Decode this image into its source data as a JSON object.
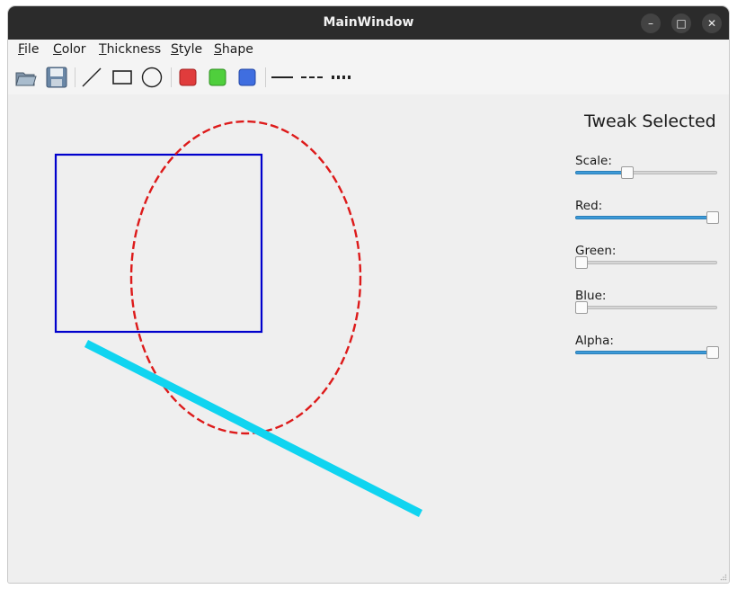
{
  "window": {
    "title": "MainWindow"
  },
  "menu": {
    "file": "File",
    "color": "Color",
    "thickness": "Thickness",
    "style": "Style",
    "shape": "Shape"
  },
  "toolbar": {
    "icons": [
      "open-folder-icon",
      "save-icon",
      "line-tool-icon",
      "rectangle-tool-icon",
      "ellipse-tool-icon",
      "red-color-icon",
      "green-color-icon",
      "blue-color-icon",
      "solid-line-style-icon",
      "dashed-line-style-icon",
      "dotted-line-style-icon"
    ],
    "colors": {
      "red": "#e03c3c",
      "green": "#4fcf3c",
      "blue": "#3f6ee0"
    }
  },
  "canvas": {
    "shapes": [
      {
        "type": "rectangle",
        "stroke": "#0000cc",
        "style": "solid"
      },
      {
        "type": "ellipse",
        "stroke": "#dd1a1a",
        "style": "dashed"
      },
      {
        "type": "line",
        "stroke": "#10d4f0",
        "style": "solid"
      }
    ]
  },
  "panel": {
    "title": "Tweak Selected",
    "sliders": [
      {
        "label": "Scale:",
        "value": 0.35
      },
      {
        "label": "Red:",
        "value": 1.0
      },
      {
        "label": "Green:",
        "value": 0.0
      },
      {
        "label": "Blue:",
        "value": 0.0
      },
      {
        "label": "Alpha:",
        "value": 1.0
      }
    ],
    "accent": "#3d9ad8"
  }
}
